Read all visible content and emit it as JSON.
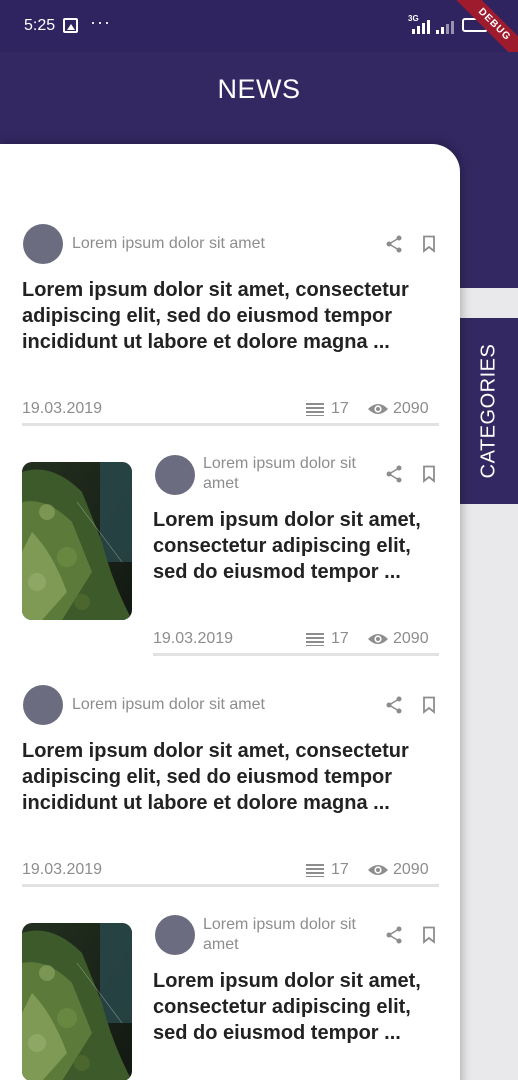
{
  "status_bar": {
    "time": "5:25",
    "network": "3G",
    "ribbon": "DEBUG"
  },
  "header": {
    "title": "NEWS"
  },
  "categories_tab": {
    "label": "CATEGORIES"
  },
  "colors": {
    "primary": "#342862",
    "avatar": "#6c6c80",
    "muted": "#8d8d8d"
  },
  "articles": [
    {
      "author": "Lorem ipsum dolor sit amet",
      "title": "Lorem ipsum dolor sit amet, consectetur adipiscing elit, sed do eiusmod tempor incididunt ut labore et dolore magna ...",
      "date": "19.03.2019",
      "comments": "17",
      "views": "2090"
    },
    {
      "author": "Lorem ipsum dolor sit amet",
      "title": "Lorem ipsum dolor sit amet, consectetur adipiscing elit, sed do eiusmod tempor ...",
      "date": "19.03.2019",
      "comments": "17",
      "views": "2090"
    },
    {
      "author": "Lorem ipsum dolor sit amet",
      "title": "Lorem ipsum dolor sit amet, consectetur adipiscing elit, sed do eiusmod tempor incididunt ut labore et dolore magna ...",
      "date": "19.03.2019",
      "comments": "17",
      "views": "2090"
    },
    {
      "author": "Lorem ipsum dolor sit amet",
      "title": "Lorem ipsum dolor sit amet, consectetur adipiscing elit, sed do eiusmod tempor ..."
    }
  ]
}
